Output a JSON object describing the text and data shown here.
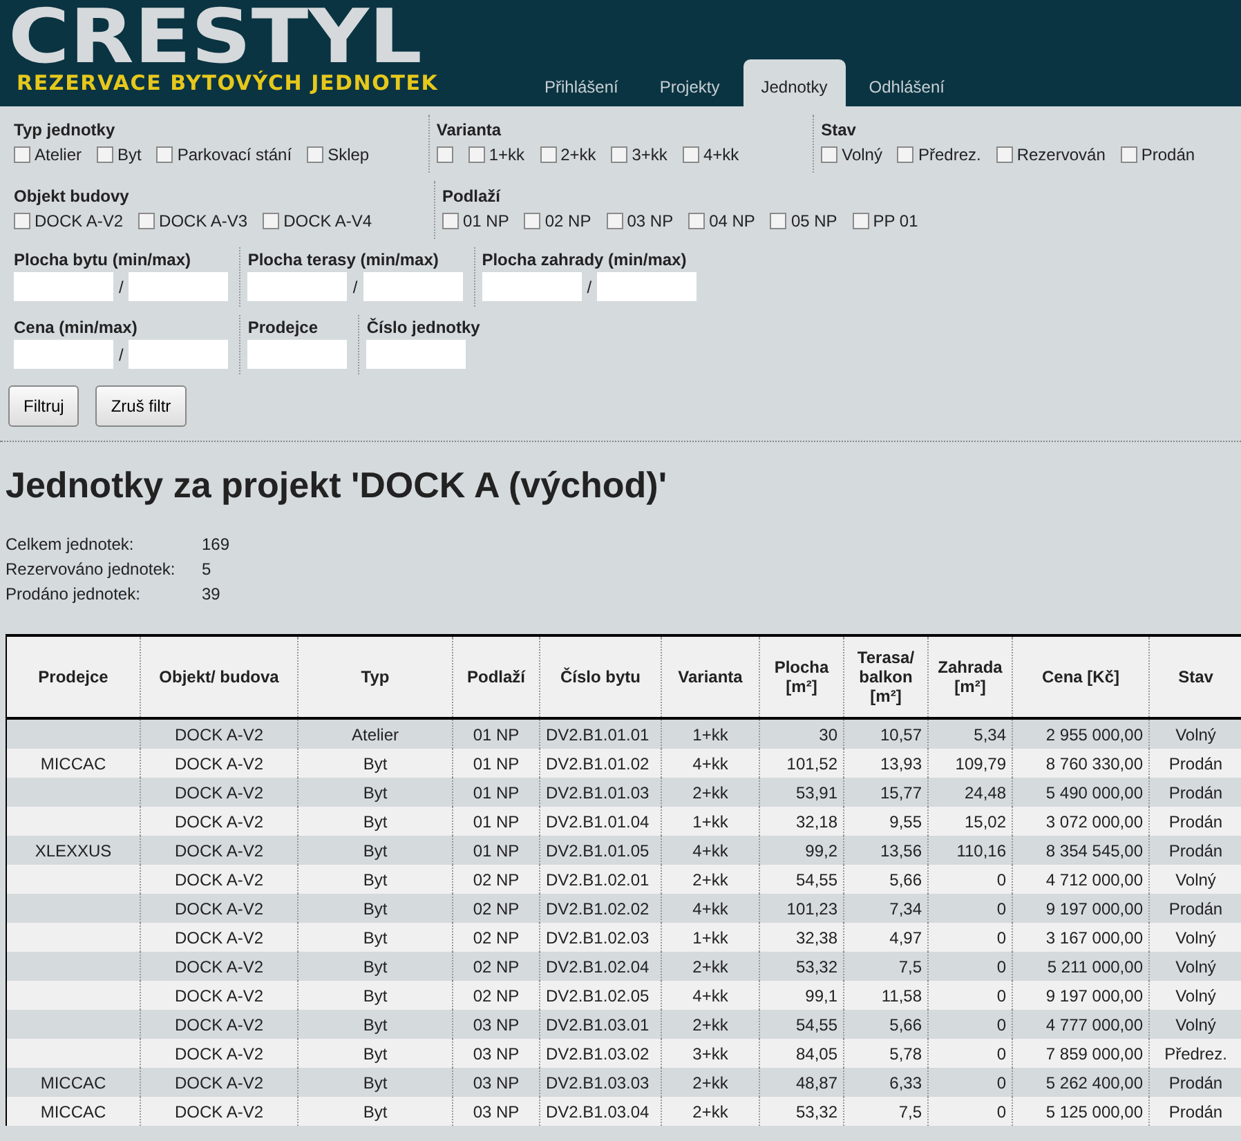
{
  "header": {
    "logo": "CRESTYL",
    "subtitle": "REZERVACE BYTOVÝCH JEDNOTEK",
    "tabs": [
      {
        "label": "Přihlášení",
        "selected": false
      },
      {
        "label": "Projekty",
        "selected": false
      },
      {
        "label": "Jednotky",
        "selected": true
      },
      {
        "label": "Odhlášení",
        "selected": false
      }
    ]
  },
  "filters": {
    "checkbox_rows": [
      [
        {
          "title": "Typ jednotky",
          "options": [
            {
              "label": "Atelier",
              "checked": false
            },
            {
              "label": "Byt",
              "checked": false
            },
            {
              "label": "Parkovací stání",
              "checked": false
            },
            {
              "label": "Sklep",
              "checked": false
            }
          ]
        },
        {
          "title": "Varianta",
          "options": [
            {
              "checked": false
            },
            {
              "label": "1+kk",
              "checked": false
            },
            {
              "label": "2+kk",
              "checked": false
            },
            {
              "label": "3+kk",
              "checked": false
            },
            {
              "label": "4+kk",
              "checked": false
            }
          ]
        },
        {
          "title": "Stav",
          "options": [
            {
              "label": "Volný",
              "checked": false
            },
            {
              "label": "Předrez.",
              "checked": false
            },
            {
              "label": "Rezervován",
              "checked": false
            },
            {
              "label": "Prodán",
              "checked": false
            }
          ]
        }
      ],
      [
        {
          "title": "Objekt budovy",
          "options": [
            {
              "label": "DOCK A-V2",
              "checked": false
            },
            {
              "label": "DOCK A-V3",
              "checked": false
            },
            {
              "label": "DOCK A-V4",
              "checked": false
            }
          ]
        },
        {
          "title": "Podlaží",
          "options": [
            {
              "label": "01 NP",
              "checked": false
            },
            {
              "label": "02 NP",
              "checked": false
            },
            {
              "label": "03 NP",
              "checked": false
            },
            {
              "label": "04 NP",
              "checked": false
            },
            {
              "label": "05 NP",
              "checked": false
            },
            {
              "label": "PP 01",
              "checked": false
            }
          ]
        }
      ]
    ],
    "field_rows": [
      [
        {
          "label": "Plocha bytu (min/max)",
          "kind": "range",
          "separator": "/"
        },
        {
          "label": "Plocha terasy (min/max)",
          "kind": "range",
          "separator": "/"
        },
        {
          "label": "Plocha zahrady (min/max)",
          "kind": "range",
          "separator": "/"
        }
      ],
      [
        {
          "label": "Cena (min/max)",
          "kind": "range",
          "separator": "/"
        },
        {
          "label": "Prodejce",
          "kind": "single"
        },
        {
          "label": "Číslo jednotky",
          "kind": "single"
        }
      ]
    ],
    "buttons": [
      "Filtruj",
      "Zruš filtr"
    ]
  },
  "title": "Jednotky za projekt 'DOCK A (východ)'",
  "stats": [
    {
      "label": "Celkem jednotek:",
      "value": "169"
    },
    {
      "label": "Rezervováno jednotek:",
      "value": "5"
    },
    {
      "label": "Prodáno jednotek:",
      "value": "39"
    }
  ],
  "table": {
    "columns": [
      "Prodejce",
      "Objekt/ budova",
      "Typ",
      "Podlaží",
      "Číslo bytu",
      "Varianta",
      "Plocha [m²]",
      "Terasa/ balkon [m²]",
      "Zahrada [m²]",
      "Cena [Kč]",
      "Stav"
    ],
    "rows": [
      [
        "",
        "DOCK A-V2",
        "Atelier",
        "01 NP",
        "DV2.B1.01.01",
        "1+kk",
        "30",
        "10,57",
        "5,34",
        "2 955 000,00",
        "Volný"
      ],
      [
        "MICCAC",
        "DOCK A-V2",
        "Byt",
        "01 NP",
        "DV2.B1.01.02",
        "4+kk",
        "101,52",
        "13,93",
        "109,79",
        "8 760 330,00",
        "Prodán"
      ],
      [
        "",
        "DOCK A-V2",
        "Byt",
        "01 NP",
        "DV2.B1.01.03",
        "2+kk",
        "53,91",
        "15,77",
        "24,48",
        "5 490 000,00",
        "Prodán"
      ],
      [
        "",
        "DOCK A-V2",
        "Byt",
        "01 NP",
        "DV2.B1.01.04",
        "1+kk",
        "32,18",
        "9,55",
        "15,02",
        "3 072 000,00",
        "Prodán"
      ],
      [
        "XLEXXUS",
        "DOCK A-V2",
        "Byt",
        "01 NP",
        "DV2.B1.01.05",
        "4+kk",
        "99,2",
        "13,56",
        "110,16",
        "8 354 545,00",
        "Prodán"
      ],
      [
        "",
        "DOCK A-V2",
        "Byt",
        "02 NP",
        "DV2.B1.02.01",
        "2+kk",
        "54,55",
        "5,66",
        "0",
        "4 712 000,00",
        "Volný"
      ],
      [
        "",
        "DOCK A-V2",
        "Byt",
        "02 NP",
        "DV2.B1.02.02",
        "4+kk",
        "101,23",
        "7,34",
        "0",
        "9 197 000,00",
        "Prodán"
      ],
      [
        "",
        "DOCK A-V2",
        "Byt",
        "02 NP",
        "DV2.B1.02.03",
        "1+kk",
        "32,38",
        "4,97",
        "0",
        "3 167 000,00",
        "Volný"
      ],
      [
        "",
        "DOCK A-V2",
        "Byt",
        "02 NP",
        "DV2.B1.02.04",
        "2+kk",
        "53,32",
        "7,5",
        "0",
        "5 211 000,00",
        "Volný"
      ],
      [
        "",
        "DOCK A-V2",
        "Byt",
        "02 NP",
        "DV2.B1.02.05",
        "4+kk",
        "99,1",
        "11,58",
        "0",
        "9 197 000,00",
        "Volný"
      ],
      [
        "",
        "DOCK A-V2",
        "Byt",
        "03 NP",
        "DV2.B1.03.01",
        "2+kk",
        "54,55",
        "5,66",
        "0",
        "4 777 000,00",
        "Volný"
      ],
      [
        "",
        "DOCK A-V2",
        "Byt",
        "03 NP",
        "DV2.B1.03.02",
        "3+kk",
        "84,05",
        "5,78",
        "0",
        "7 859 000,00",
        "Předrez."
      ],
      [
        "MICCAC",
        "DOCK A-V2",
        "Byt",
        "03 NP",
        "DV2.B1.03.03",
        "2+kk",
        "48,87",
        "6,33",
        "0",
        "5 262 400,00",
        "Prodán"
      ],
      [
        "MICCAC",
        "DOCK A-V2",
        "Byt",
        "03 NP",
        "DV2.B1.03.04",
        "2+kk",
        "53,32",
        "7,5",
        "0",
        "5 125 000,00",
        "Prodán"
      ]
    ]
  }
}
